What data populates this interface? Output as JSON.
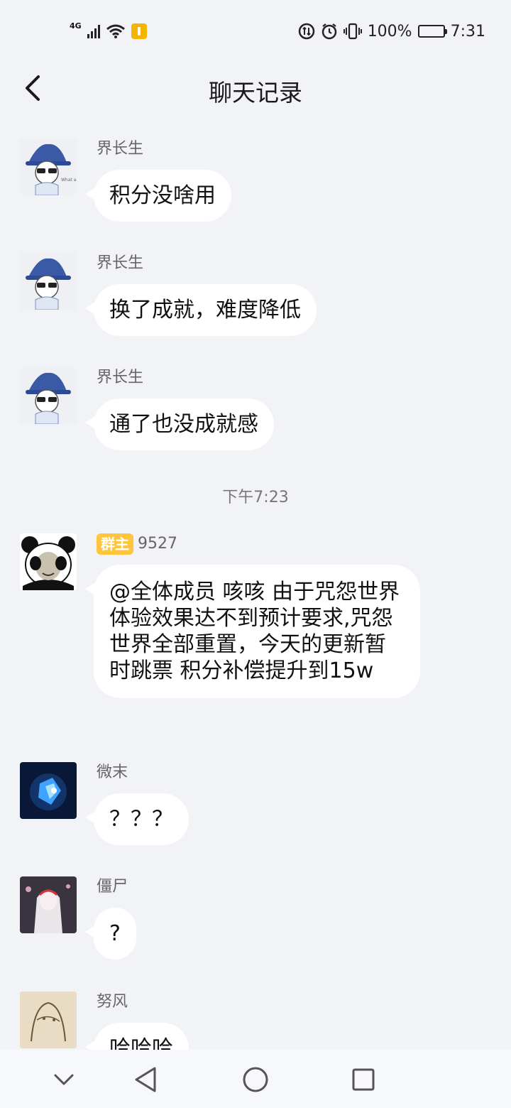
{
  "status_bar": {
    "network": "4G",
    "battery_pct": "100%",
    "time": "7:31"
  },
  "header": {
    "title": "聊天记录"
  },
  "messages": [
    {
      "sender": "界长生",
      "text": "积分没啥用"
    },
    {
      "sender": "界长生",
      "text": "换了成就，难度降低"
    },
    {
      "sender": "界长生",
      "text": "通了也没成就感"
    },
    {
      "sender": "9527",
      "badge": "群主",
      "text": "@全体成员  咳咳  由于咒怨世界体验效果达不到预计要求,咒怨世界全部重置，今天的更新暂时跳票 积分补偿提升到15w"
    },
    {
      "sender": "微末",
      "text": "？？？"
    },
    {
      "sender": "僵尸",
      "text": "?"
    },
    {
      "sender": "努风",
      "text": "哈哈哈"
    }
  ],
  "timestamp_divider": "下午7:23",
  "colors": {
    "background": "#f2f3f7",
    "bubble": "#ffffff",
    "owner_badge": "#ffc53d"
  }
}
